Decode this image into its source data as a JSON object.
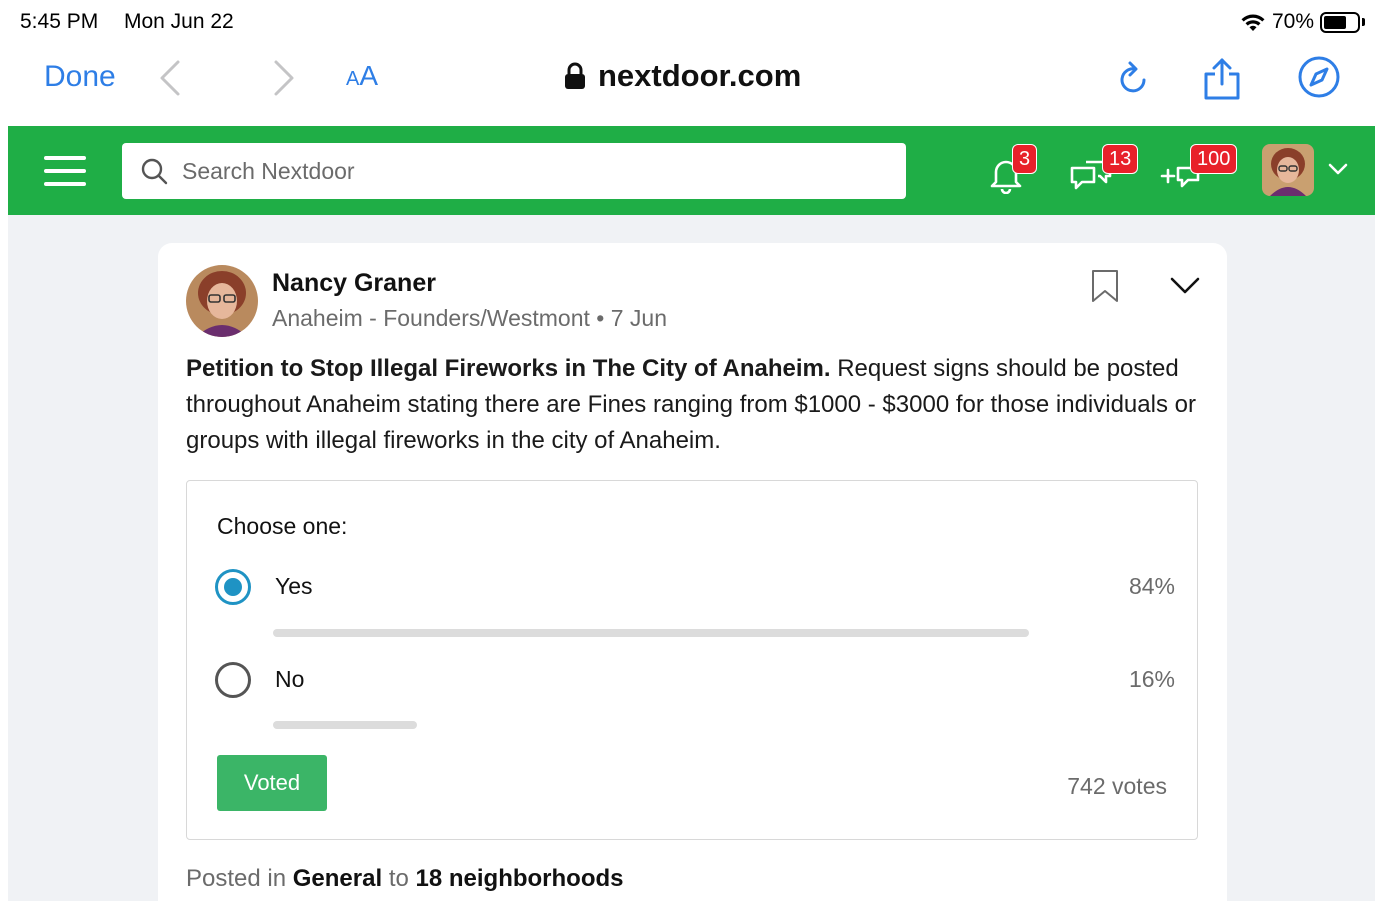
{
  "status_bar": {
    "time": "5:45 PM",
    "date": "Mon Jun 22",
    "battery_percent": "70%",
    "battery_level": 0.7
  },
  "browser": {
    "done_label": "Done",
    "text_size_small": "A",
    "text_size_large": "A",
    "url": "nextdoor.com"
  },
  "nav": {
    "search_placeholder": "Search Nextdoor",
    "notifications_count": "3",
    "messages_count": "13",
    "invites_count": "100",
    "brand_color": "#1fae46",
    "badge_color": "#e8212a"
  },
  "post": {
    "author_name": "Nancy Graner",
    "author_neighborhood": "Anaheim - Founders/Westmont",
    "separator": "•",
    "date": "7 Jun",
    "title": "Petition to Stop Illegal Fireworks in The City of Anaheim.",
    "body": "Request signs should be posted throughout Anaheim stating  there are Fines ranging from $1000 - $3000 for those individuals or groups with illegal fireworks in the city of Anaheim.",
    "poll": {
      "prompt": "Choose one:",
      "options": [
        {
          "label": "Yes",
          "percent_label": "84%",
          "share": 0.84,
          "selected": true
        },
        {
          "label": "No",
          "percent_label": "16%",
          "share": 0.16,
          "selected": false
        }
      ],
      "voted_label": "Voted",
      "votes_label": "742 votes",
      "accent_color": "#1f93c4",
      "voted_color": "#3bb567"
    },
    "posted_in_prefix": "Posted in",
    "category": "General",
    "posted_to_word": "to",
    "audience": "18 neighborhoods"
  }
}
